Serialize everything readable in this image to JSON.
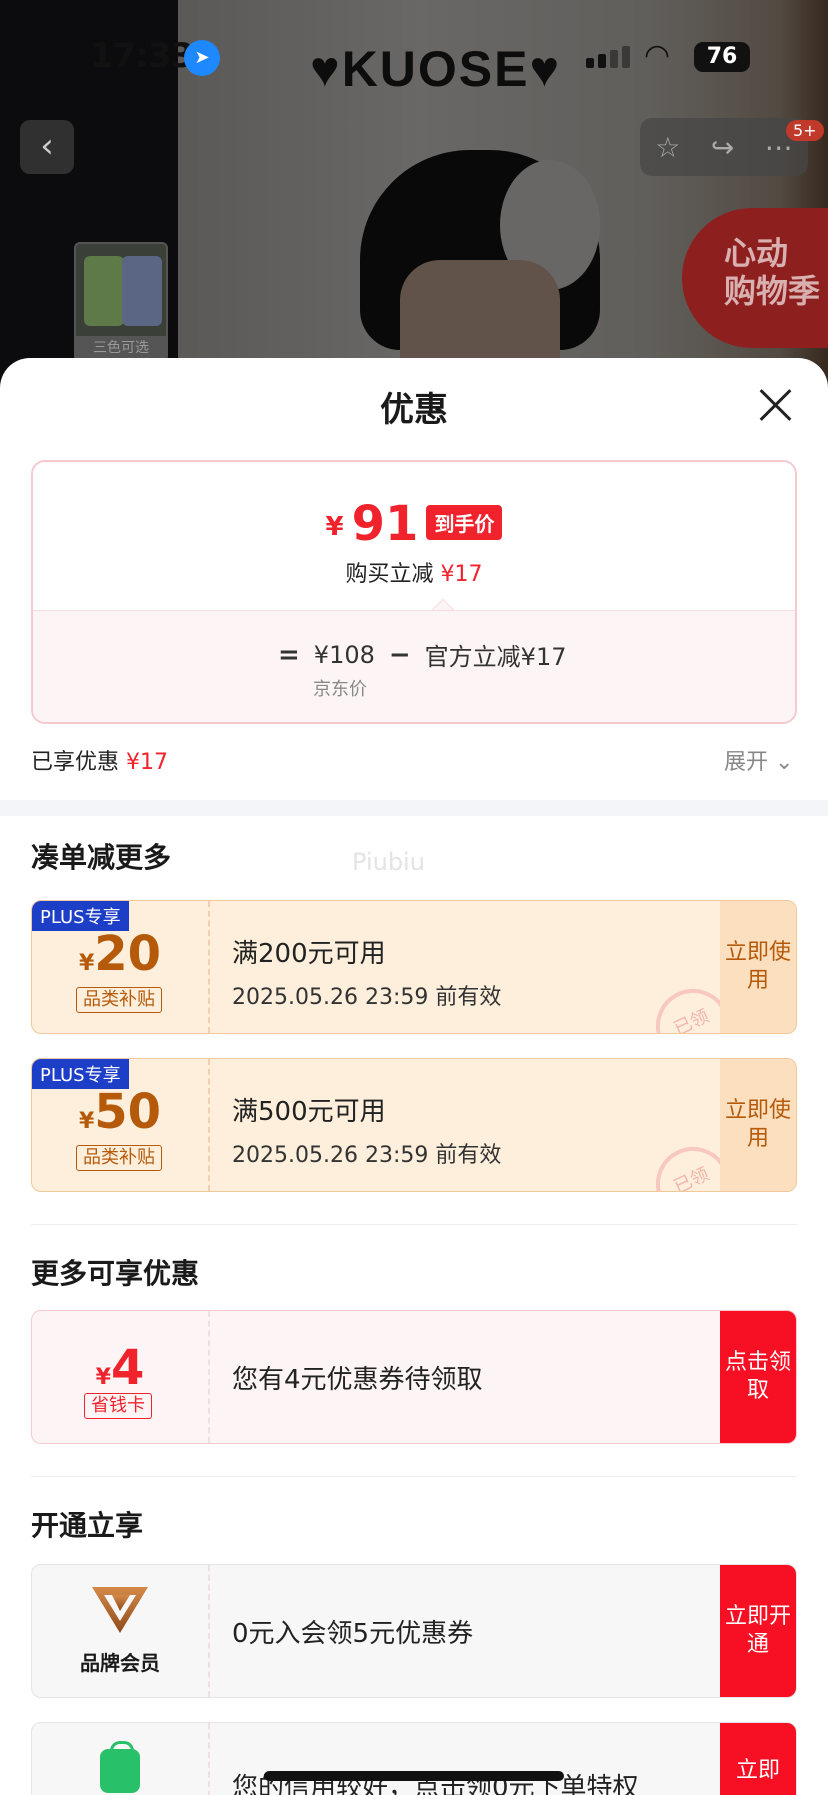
{
  "status_bar": {
    "time": "17:33",
    "battery": "76"
  },
  "background": {
    "brand": "♥KUOSE♥",
    "badge_count": "5+",
    "thumbnail_caption": "三色可选",
    "promo_line1": "心动",
    "promo_line2": "购物季"
  },
  "sheet": {
    "title": "优惠",
    "price": {
      "currency": "¥",
      "final_price": "91",
      "final_tag": "到手价",
      "instant_label": "购买立减",
      "instant_amount": "¥17",
      "eq": "=",
      "jd_price": "¥108",
      "minus": "−",
      "official_cut": "官方立减¥17",
      "jd_label": "京东价"
    },
    "enjoyed_label": "已享优惠",
    "enjoyed_amount": "¥17",
    "expand_label": "展开",
    "section_more": "凑单减更多",
    "watermark": "Piubiu",
    "coupons": [
      {
        "tag": "PLUS专享",
        "currency": "¥",
        "amount": "20",
        "type": "品类补贴",
        "condition": "满200元可用",
        "expiry": "2025.05.26 23:59 前有效",
        "button": "立即使用",
        "stamp": "已领"
      },
      {
        "tag": "PLUS专享",
        "currency": "¥",
        "amount": "50",
        "type": "品类补贴",
        "condition": "满500元可用",
        "expiry": "2025.05.26 23:59 前有效",
        "button": "立即使用",
        "stamp": "已领"
      }
    ],
    "section_enjoy": "更多可享优惠",
    "saving_card": {
      "currency": "¥",
      "amount": "4",
      "type": "省钱卡",
      "desc": "您有4元优惠券待领取",
      "button": "点击领取"
    },
    "section_open": "开通立享",
    "brand_member": {
      "label": "品牌会员",
      "desc": "0元入会领5元优惠券",
      "button": "立即开通"
    },
    "credit": {
      "desc": "您的信用较好，点击领0元下单特权",
      "button": "立即"
    }
  }
}
